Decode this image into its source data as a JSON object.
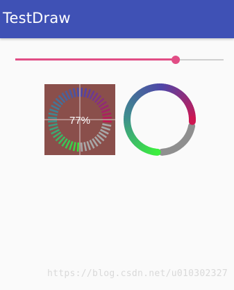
{
  "app": {
    "title": "TestDraw",
    "header_color": "#3f51b5"
  },
  "slider": {
    "value": 0.77,
    "accent_color": "#e14d85",
    "track_color": "#cfcfcf"
  },
  "gauge_segmented": {
    "percent_label": "77%",
    "progress": 0.77,
    "background_color": "#8a4f4b",
    "inactive_color": "#a8a8a8",
    "gradient_colors": [
      "#3ae03a",
      "#3e8e8e",
      "#4e46a8",
      "#c5154f"
    ]
  },
  "gauge_ring": {
    "progress": 0.77,
    "inactive_color": "#8f8f8f",
    "gradient_colors": [
      "#3cf03c",
      "#3e8e8e",
      "#4e46a8",
      "#d0154f"
    ]
  },
  "watermark": {
    "text": "https://blog.csdn.net/u010302327"
  }
}
